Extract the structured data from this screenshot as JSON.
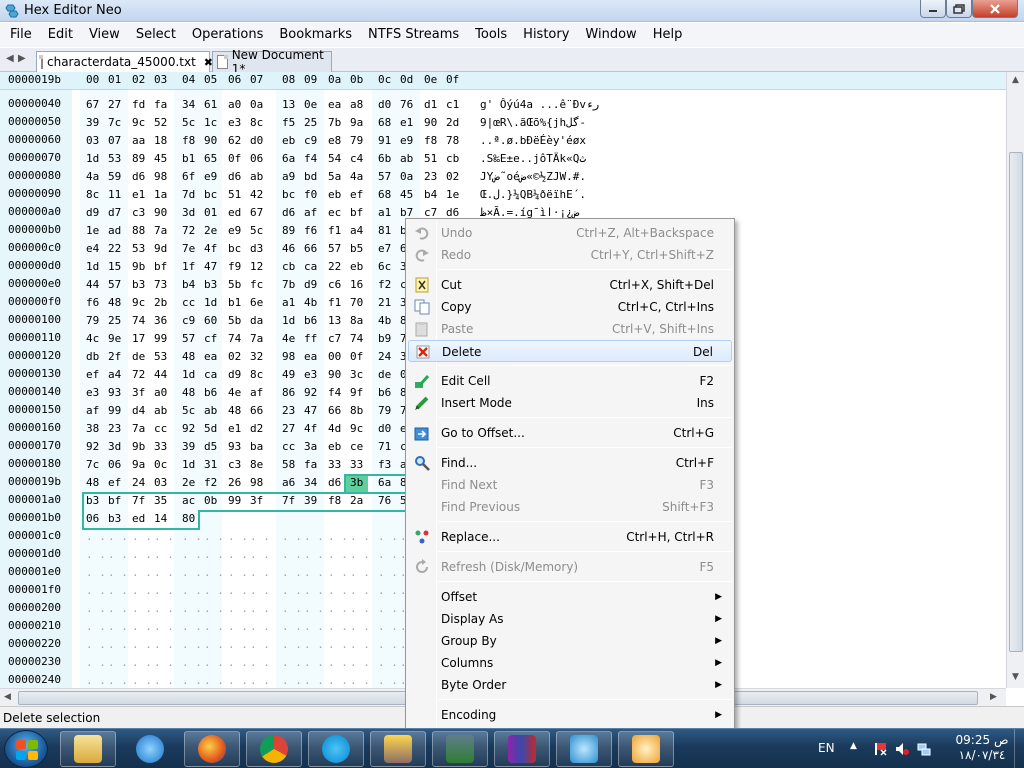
{
  "window": {
    "title": "Hex Editor Neo"
  },
  "menubar": [
    "File",
    "Edit",
    "View",
    "Select",
    "Operations",
    "Bookmarks",
    "NTFS Streams",
    "Tools",
    "History",
    "Window",
    "Help"
  ],
  "tabs": [
    {
      "label": "characterdata_45000.txt",
      "active": true,
      "close": "✖"
    },
    {
      "label": "New Document 1*",
      "active": false
    }
  ],
  "editor": {
    "current_offset": "0000019b",
    "column_headers": [
      "00",
      "01",
      "02",
      "03",
      "04",
      "05",
      "06",
      "07",
      "08",
      "09",
      "0a",
      "0b",
      "0c",
      "0d",
      "0e",
      "0f"
    ],
    "rows": [
      {
        "offset": "00000040",
        "bytes": [
          "67",
          "27",
          "fd",
          "fa",
          "34",
          "61",
          "a0",
          "0a",
          "13",
          "0e",
          "ea",
          "a8",
          "d0",
          "76",
          "d1",
          "c1"
        ],
        "ascii": "g' Ôýú4a ...ê¨Ðvرء"
      },
      {
        "offset": "00000050",
        "bytes": [
          "39",
          "7c",
          "9c",
          "52",
          "5c",
          "1c",
          "e3",
          "8c",
          "f5",
          "25",
          "7b",
          "9a",
          "68",
          "e1",
          "90",
          "2d"
        ],
        "ascii": "9|œR\\.ãŒõ%{jhگل-"
      },
      {
        "offset": "00000060",
        "bytes": [
          "03",
          "07",
          "aa",
          "18",
          "f8",
          "90",
          "62",
          "d0",
          "eb",
          "c9",
          "e8",
          "79",
          "91",
          "e9",
          "f8",
          "78"
        ],
        "ascii": "..ª.ø.bÐëÉèy'éøx"
      },
      {
        "offset": "00000070",
        "bytes": [
          "1d",
          "53",
          "89",
          "45",
          "b1",
          "65",
          "0f",
          "06",
          "6a",
          "f4",
          "54",
          "c4",
          "6b",
          "ab",
          "51",
          "cb"
        ],
        "ascii": ".S‰E±e..jôTÄk«Qث"
      },
      {
        "offset": "00000080",
        "bytes": [
          "4a",
          "59",
          "d6",
          "98",
          "6f",
          "e9",
          "d6",
          "ab",
          "a9",
          "bd",
          "5a",
          "4a",
          "57",
          "0a",
          "23",
          "02"
        ],
        "ascii": "JYض˜oéض«©½ZJW.#."
      },
      {
        "offset": "00000090",
        "bytes": [
          "8c",
          "11",
          "e1",
          "1a",
          "7d",
          "bc",
          "51",
          "42",
          "bc",
          "f0",
          "eb",
          "ef",
          "68",
          "45",
          "b4",
          "1e"
        ],
        "ascii": "Œ.ل.}¼QB¼ðëïhE´."
      },
      {
        "offset": "000000a0",
        "bytes": [
          "d9",
          "d7",
          "c3",
          "90",
          "3d",
          "01",
          "ed",
          "67",
          "d6",
          "af",
          "ec",
          "bf",
          "a1",
          "b7",
          "c7",
          "d6"
        ],
        "ascii": "ظ×Ã.=.íg¯ìض¿¡·ا"
      },
      {
        "offset": "000000b0",
        "bytes": [
          "1e",
          "ad",
          "88",
          "7a",
          "72",
          "2e",
          "e9",
          "5c",
          "89",
          "f6",
          "f1",
          "a4",
          "81",
          "bd",
          "",
          ""
        ],
        "ascii": ""
      },
      {
        "offset": "000000c0",
        "bytes": [
          "e4",
          "22",
          "53",
          "9d",
          "7e",
          "4f",
          "bc",
          "d3",
          "46",
          "66",
          "57",
          "b5",
          "e7",
          "6",
          "",
          ""
        ],
        "ascii": ""
      },
      {
        "offset": "000000d0",
        "bytes": [
          "1d",
          "15",
          "9b",
          "bf",
          "1f",
          "47",
          "f9",
          "12",
          "cb",
          "ca",
          "22",
          "eb",
          "6c",
          "3",
          "",
          ""
        ],
        "ascii": ""
      },
      {
        "offset": "000000e0",
        "bytes": [
          "44",
          "57",
          "b3",
          "73",
          "b4",
          "b3",
          "5b",
          "fc",
          "7b",
          "d9",
          "c6",
          "16",
          "f2",
          "c",
          "",
          ""
        ],
        "ascii": ""
      },
      {
        "offset": "000000f0",
        "bytes": [
          "f6",
          "48",
          "9c",
          "2b",
          "cc",
          "1d",
          "b1",
          "6e",
          "a1",
          "4b",
          "f1",
          "70",
          "21",
          "3",
          "",
          ""
        ],
        "ascii": ""
      },
      {
        "offset": "00000100",
        "bytes": [
          "79",
          "25",
          "74",
          "36",
          "c9",
          "60",
          "5b",
          "da",
          "1d",
          "b6",
          "13",
          "8a",
          "4b",
          "8",
          "",
          ""
        ],
        "ascii": ""
      },
      {
        "offset": "00000110",
        "bytes": [
          "4c",
          "9e",
          "17",
          "99",
          "57",
          "cf",
          "74",
          "7a",
          "4e",
          "ff",
          "c7",
          "74",
          "b9",
          "7",
          "",
          ""
        ],
        "ascii": ""
      },
      {
        "offset": "00000120",
        "bytes": [
          "db",
          "2f",
          "de",
          "53",
          "48",
          "ea",
          "02",
          "32",
          "98",
          "ea",
          "00",
          "0f",
          "24",
          "3",
          "",
          ""
        ],
        "ascii": ""
      },
      {
        "offset": "00000130",
        "bytes": [
          "ef",
          "a4",
          "72",
          "44",
          "1d",
          "ca",
          "d9",
          "8c",
          "49",
          "e3",
          "90",
          "3c",
          "de",
          "0",
          "",
          ""
        ],
        "ascii": ""
      },
      {
        "offset": "00000140",
        "bytes": [
          "e3",
          "93",
          "3f",
          "a0",
          "48",
          "b6",
          "4e",
          "af",
          "86",
          "92",
          "f4",
          "9f",
          "b6",
          "8",
          "",
          ""
        ],
        "ascii": ""
      },
      {
        "offset": "00000150",
        "bytes": [
          "af",
          "99",
          "d4",
          "ab",
          "5c",
          "ab",
          "48",
          "66",
          "23",
          "47",
          "66",
          "8b",
          "79",
          "7",
          "",
          ""
        ],
        "ascii": ""
      },
      {
        "offset": "00000160",
        "bytes": [
          "38",
          "23",
          "7a",
          "cc",
          "92",
          "5d",
          "e1",
          "d2",
          "27",
          "4f",
          "4d",
          "9c",
          "d0",
          "e",
          "",
          ""
        ],
        "ascii": ""
      },
      {
        "offset": "00000170",
        "bytes": [
          "92",
          "3d",
          "9b",
          "33",
          "39",
          "d5",
          "93",
          "ba",
          "cc",
          "3a",
          "eb",
          "ce",
          "71",
          "c",
          "",
          ""
        ],
        "ascii": ""
      },
      {
        "offset": "00000180",
        "bytes": [
          "7c",
          "06",
          "9a",
          "0c",
          "1d",
          "31",
          "c3",
          "8e",
          "58",
          "fa",
          "33",
          "33",
          "f3",
          "a",
          "",
          ""
        ],
        "ascii": ""
      },
      {
        "offset": "0000019b",
        "bytes": [
          "48",
          "ef",
          "24",
          "03",
          "2e",
          "f2",
          "26",
          "98",
          "a6",
          "34",
          "d6",
          "3b",
          "6a",
          "8",
          "",
          ""
        ],
        "ascii": ""
      },
      {
        "offset": "000001a0",
        "bytes": [
          "b3",
          "bf",
          "7f",
          "35",
          "ac",
          "0b",
          "99",
          "3f",
          "7f",
          "39",
          "f8",
          "2a",
          "76",
          "5",
          "",
          ""
        ],
        "ascii": ""
      },
      {
        "offset": "000001b0",
        "bytes": [
          "06",
          "b3",
          "ed",
          "14",
          "80",
          "",
          "",
          "",
          "",
          "",
          "",
          "",
          "",
          "",
          "",
          ""
        ],
        "ascii": ""
      },
      {
        "offset": "000001c0",
        "bytes": [],
        "ascii": ""
      },
      {
        "offset": "000001d0",
        "bytes": [],
        "ascii": ""
      },
      {
        "offset": "000001e0",
        "bytes": [],
        "ascii": ""
      },
      {
        "offset": "000001f0",
        "bytes": [],
        "ascii": ""
      },
      {
        "offset": "00000200",
        "bytes": [],
        "ascii": ""
      },
      {
        "offset": "00000210",
        "bytes": [],
        "ascii": ""
      },
      {
        "offset": "00000220",
        "bytes": [],
        "ascii": ""
      },
      {
        "offset": "00000230",
        "bytes": [],
        "ascii": ""
      },
      {
        "offset": "00000240",
        "bytes": [],
        "ascii": ""
      }
    ],
    "empty_cell": ". ."
  },
  "status": {
    "text": "Delete selection"
  },
  "context_menu": [
    {
      "type": "item",
      "label": "Undo",
      "shortcut": "Ctrl+Z, Alt+Backspace",
      "disabled": true,
      "icon": "undo-icon"
    },
    {
      "type": "item",
      "label": "Redo",
      "shortcut": "Ctrl+Y, Ctrl+Shift+Z",
      "disabled": true,
      "icon": "redo-icon"
    },
    {
      "type": "sep"
    },
    {
      "type": "item",
      "label": "Cut",
      "shortcut": "Ctrl+X, Shift+Del",
      "icon": "cut-icon"
    },
    {
      "type": "item",
      "label": "Copy",
      "shortcut": "Ctrl+C, Ctrl+Ins",
      "icon": "copy-icon"
    },
    {
      "type": "item",
      "label": "Paste",
      "shortcut": "Ctrl+V, Shift+Ins",
      "disabled": true,
      "icon": "paste-icon"
    },
    {
      "type": "item",
      "label": "Delete",
      "shortcut": "Del",
      "highlighted": true,
      "icon": "delete-icon"
    },
    {
      "type": "sep"
    },
    {
      "type": "item",
      "label": "Edit Cell",
      "shortcut": "F2",
      "icon": "edit-cell-icon"
    },
    {
      "type": "item",
      "label": "Insert Mode",
      "shortcut": "Ins",
      "icon": "insert-mode-icon"
    },
    {
      "type": "sep"
    },
    {
      "type": "item",
      "label": "Go to Offset...",
      "shortcut": "Ctrl+G",
      "icon": "goto-icon"
    },
    {
      "type": "sep"
    },
    {
      "type": "item",
      "label": "Find...",
      "shortcut": "Ctrl+F",
      "icon": "find-icon"
    },
    {
      "type": "item",
      "label": "Find Next",
      "shortcut": "F3",
      "disabled": true,
      "icon": "none"
    },
    {
      "type": "item",
      "label": "Find Previous",
      "shortcut": "Shift+F3",
      "disabled": true,
      "icon": "none"
    },
    {
      "type": "sep"
    },
    {
      "type": "item",
      "label": "Replace...",
      "shortcut": "Ctrl+H, Ctrl+R",
      "icon": "replace-icon"
    },
    {
      "type": "sep"
    },
    {
      "type": "item",
      "label": "Refresh (Disk/Memory)",
      "shortcut": "F5",
      "disabled": true,
      "icon": "refresh-icon"
    },
    {
      "type": "sep"
    },
    {
      "type": "item",
      "label": "Offset",
      "submenu": true,
      "icon": "none"
    },
    {
      "type": "item",
      "label": "Display As",
      "submenu": true,
      "icon": "none"
    },
    {
      "type": "item",
      "label": "Group By",
      "submenu": true,
      "icon": "none"
    },
    {
      "type": "item",
      "label": "Columns",
      "submenu": true,
      "icon": "none"
    },
    {
      "type": "item",
      "label": "Byte Order",
      "submenu": true,
      "icon": "none"
    },
    {
      "type": "sep"
    },
    {
      "type": "item",
      "label": "Encoding",
      "submenu": true,
      "icon": "none"
    }
  ],
  "taskbar": {
    "apps": [
      "windows-explorer",
      "internet-explorer",
      "firefox",
      "chrome",
      "skype",
      "tools",
      "task-manager",
      "winrar",
      "hex-editor-neo",
      "paint"
    ],
    "tray": {
      "language": "EN",
      "time": "09:25 ص",
      "date": "١٨/٠٧/٣٤"
    }
  },
  "colors": {
    "accent": "#34b6a5",
    "cursor": "#5fcf9d",
    "offset_bg": "#e6f6fb",
    "header_bg": "#dff4fa"
  }
}
